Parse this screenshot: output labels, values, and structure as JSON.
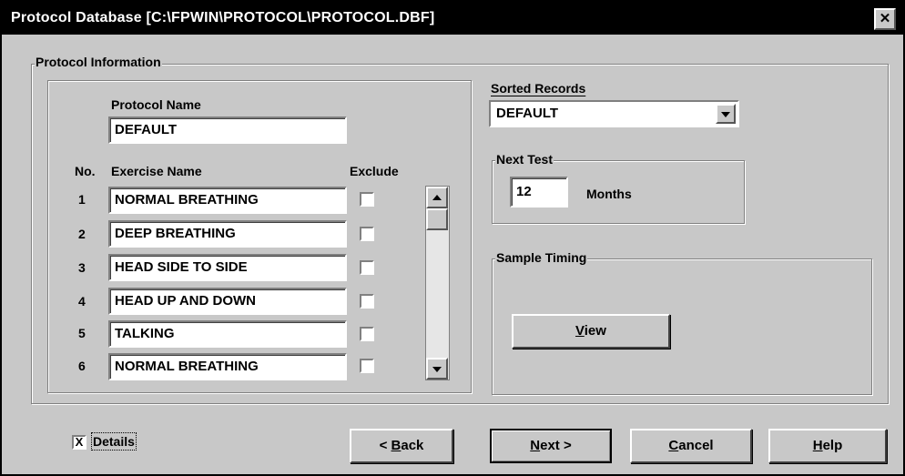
{
  "window": {
    "title": "Protocol Database [C:\\FPWIN\\PROTOCOL\\PROTOCOL.DBF]",
    "close_glyph": "✕"
  },
  "protocol_info": {
    "legend": "Protocol Information",
    "name_label": "Protocol Name",
    "name_value": "DEFAULT",
    "col_no": "No.",
    "col_exercise": "Exercise Name",
    "col_exclude": "Exclude",
    "rows": [
      {
        "no": "1",
        "exercise": "NORMAL BREATHING",
        "excluded": false
      },
      {
        "no": "2",
        "exercise": "DEEP BREATHING",
        "excluded": false
      },
      {
        "no": "3",
        "exercise": "HEAD SIDE TO SIDE",
        "excluded": false
      },
      {
        "no": "4",
        "exercise": "HEAD UP AND DOWN",
        "excluded": false
      },
      {
        "no": "5",
        "exercise": "TALKING",
        "excluded": false
      },
      {
        "no": "6",
        "exercise": "NORMAL BREATHING",
        "excluded": false
      }
    ]
  },
  "sorted_records": {
    "label": "Sorted Records",
    "value": "DEFAULT"
  },
  "next_test": {
    "legend": "Next Test",
    "value": "12",
    "unit": "Months"
  },
  "sample_timing": {
    "legend": "Sample Timing",
    "view_label": "View",
    "view_key": "V",
    "view_rest": "iew"
  },
  "footer": {
    "details_label": "Details",
    "details_checked": true,
    "details_mark": "X",
    "back_prefix": "< ",
    "back_key": "B",
    "back_rest": "ack",
    "next_key": "N",
    "next_rest": "ext >",
    "cancel_key": "C",
    "cancel_rest": "ancel",
    "help_key": "H",
    "help_rest": "elp"
  },
  "colors": {
    "face": "#c8c8c8",
    "titlebar": "#000000",
    "field": "#ffffff"
  }
}
